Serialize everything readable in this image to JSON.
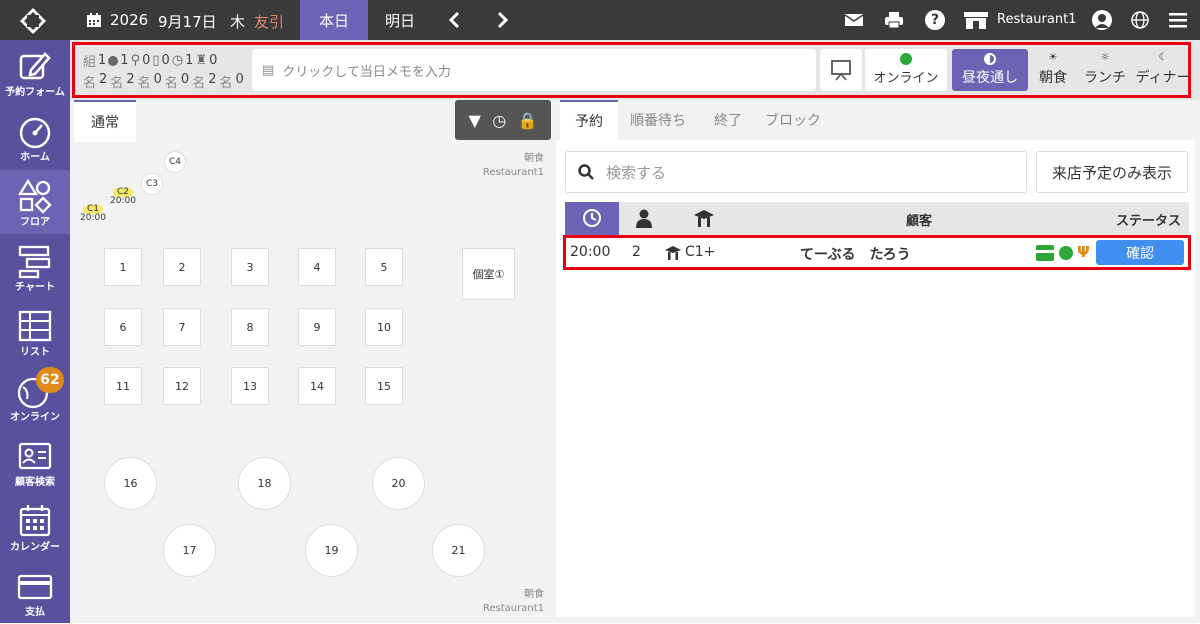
{
  "topbar": {
    "year": "2026",
    "date": "9月17日",
    "weekday": "木",
    "rokuyo": "友引",
    "today": "本日",
    "tomorrow": "明日",
    "restaurant": "Restaurant1"
  },
  "sidebar": {
    "items": [
      {
        "label": "予約フォーム"
      },
      {
        "label": "ホーム"
      },
      {
        "label": "フロア"
      },
      {
        "label": "チャート"
      },
      {
        "label": "リスト"
      },
      {
        "label": "オンライン"
      },
      {
        "label": "顧客検索"
      },
      {
        "label": "カレンダー"
      },
      {
        "label": "支払"
      }
    ],
    "online_badge": "62"
  },
  "stats": {
    "row1": [
      "組",
      "1",
      "1",
      "0",
      "0",
      "1",
      "0"
    ],
    "row2": [
      "名",
      "2",
      "2",
      "0",
      "0",
      "2",
      "0"
    ]
  },
  "memo": {
    "placeholder": "クリックして当日メモを入力"
  },
  "toolbar": {
    "online": "オンライン",
    "allday": "昼夜通し",
    "breakfast": "朝食",
    "lunch": "ランチ",
    "dinner": "ディナー"
  },
  "floor": {
    "tab": "通常",
    "meal_top": "朝食",
    "rest_top": "Restaurant1",
    "meal_bottom": "朝食",
    "rest_bottom": "Restaurant1",
    "private_room": "個室①",
    "small_tables": [
      {
        "id": "C4"
      },
      {
        "id": "C3"
      },
      {
        "id": "C2",
        "time": "20:00"
      },
      {
        "id": "C1",
        "time": "20:00"
      }
    ],
    "tables": [
      "1",
      "2",
      "3",
      "4",
      "5",
      "6",
      "7",
      "8",
      "9",
      "10",
      "11",
      "12",
      "13",
      "14",
      "15"
    ],
    "round_tables": [
      "16",
      "18",
      "20",
      "17",
      "19",
      "21"
    ]
  },
  "reservations": {
    "tabs": [
      "予約",
      "順番待ち",
      "終了",
      "ブロック"
    ],
    "search_placeholder": "検索する",
    "filter_button": "来店予定のみ表示",
    "headers": {
      "customer": "顧客",
      "status": "ステータス"
    },
    "rows": [
      {
        "time": "20:00",
        "guests": "2",
        "table": "C1+",
        "name": "てーぶる　たろう",
        "status": "確認"
      }
    ]
  }
}
